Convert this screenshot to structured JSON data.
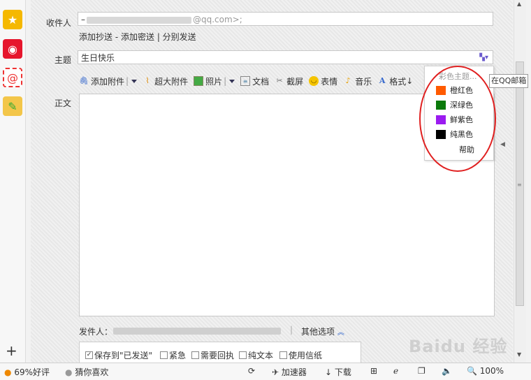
{
  "sidebar": {
    "icons": [
      "star-icon",
      "weibo-icon",
      "mail-at-icon",
      "notepad-icon"
    ],
    "add_label": "+"
  },
  "compose": {
    "recipient_label": "收件人",
    "recipient_value_prefix": "–",
    "recipient_value_suffix": "@qq.com>;",
    "links": {
      "cc": "添加抄送",
      "sep1": " - ",
      "bcc": "添加密送",
      "sep2": " | ",
      "separate": "分别发送"
    },
    "subject_label": "主题",
    "subject_value": "生日快乐",
    "body_label": "正文",
    "toolbar": {
      "attach": "添加附件",
      "big_attach": "超大附件",
      "photo": "照片",
      "doc": "文档",
      "screenshot": "截屏",
      "emoji": "表情",
      "music": "音乐",
      "format": "格式"
    },
    "sender_label": "发件人：",
    "other_options": "其他选项",
    "options": {
      "save_sent": "保存到\"已发送\"",
      "urgent": "紧急",
      "receipt": "需要回执",
      "plain_text": "纯文本",
      "stationery": "使用信纸"
    }
  },
  "color_popup": {
    "title": "彩色主题...",
    "items": [
      {
        "label": "橙红色",
        "color": "#ff5a00"
      },
      {
        "label": "深绿色",
        "color": "#0b7a0b"
      },
      {
        "label": "鲜紫色",
        "color": "#9b1bf0"
      },
      {
        "label": "纯黑色",
        "color": "#000000"
      }
    ],
    "help": "帮助"
  },
  "tooltip": "在QQ邮箱",
  "statusbar": {
    "rating": "69%好评",
    "guess": "猜你喜欢",
    "accelerator": "加速器",
    "download": "下载",
    "zoom": "100%"
  },
  "watermark": "Baidu 经验"
}
